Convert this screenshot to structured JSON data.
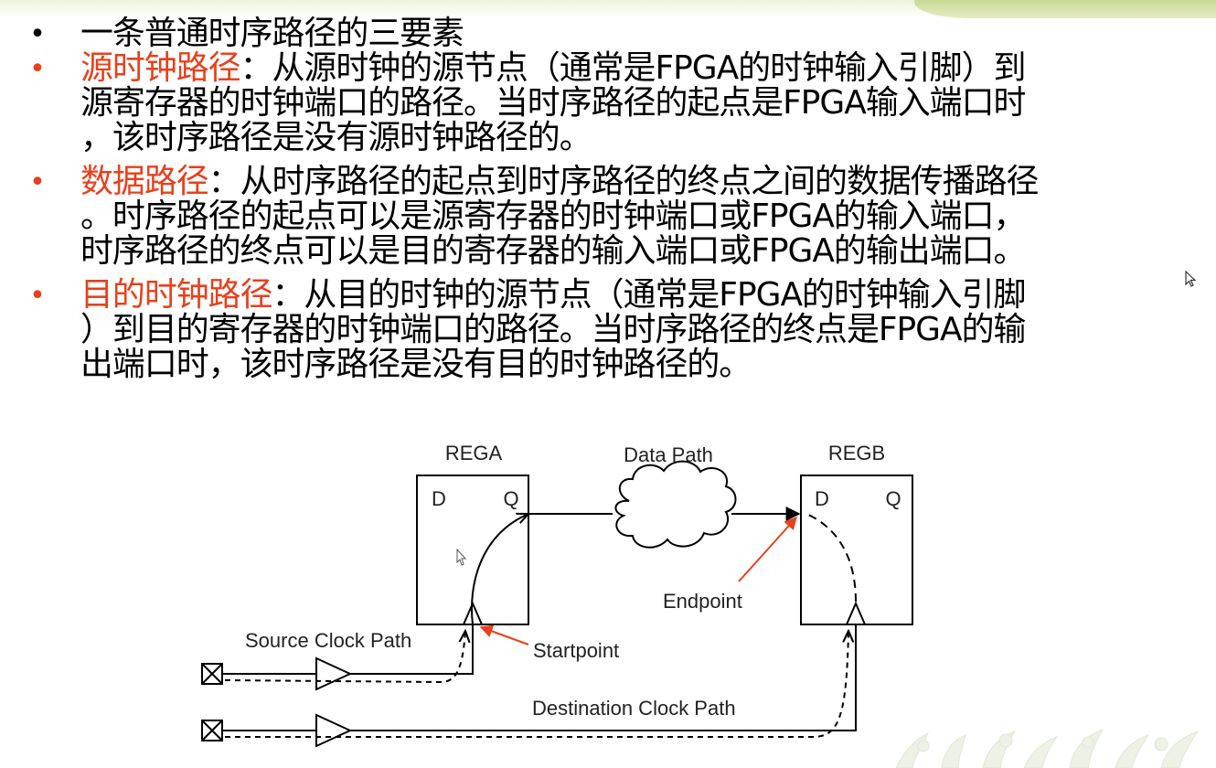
{
  "bullets": [
    {
      "color": "#000000",
      "lines": [
        {
          "highlight": "",
          "text": "一条普通时序路径的三要素"
        }
      ]
    },
    {
      "color": "#e8401c",
      "lines": [
        {
          "highlight": "源时钟路径",
          "text": "：从源时钟的源节点（通常是FPGA的时钟输入引脚）到"
        },
        {
          "highlight": "",
          "text": "源寄存器的时钟端口的路径。当时序路径的起点是FPGA输入端口时"
        },
        {
          "highlight": "",
          "text": "，该时序路径是没有源时钟路径的。"
        }
      ]
    },
    {
      "color": "#e8401c",
      "lines": [
        {
          "highlight": "数据路径",
          "text": "：从时序路径的起点到时序路径的终点之间的数据传播路径"
        },
        {
          "highlight": "",
          "text": "。时序路径的起点可以是源寄存器的时钟端口或FPGA的输入端口，"
        },
        {
          "highlight": "",
          "text": "时序路径的终点可以是目的寄存器的输入端口或FPGA的输出端口。"
        }
      ]
    },
    {
      "color": "#e8401c",
      "lines": [
        {
          "highlight": "目的时钟路径",
          "text": "：从目的时钟的源节点（通常是FPGA的时钟输入引脚"
        },
        {
          "highlight": "",
          "text": "）到目的寄存器的时钟端口的路径。当时序路径的终点是FPGA的输"
        },
        {
          "highlight": "",
          "text": "出端口时，该时序路径是没有目的时钟路径的。"
        }
      ]
    }
  ],
  "diagram": {
    "rega_label": "REGA",
    "regb_label": "REGB",
    "data_path_label": "Data Path",
    "rega_d": "D",
    "rega_q": "Q",
    "regb_d": "D",
    "regb_q": "Q",
    "endpoint_label": "Endpoint",
    "startpoint_label": "Startpoint",
    "source_clock_label": "Source Clock Path",
    "dest_clock_label": "Destination Clock Path",
    "annotation_color": "#e8401c"
  }
}
